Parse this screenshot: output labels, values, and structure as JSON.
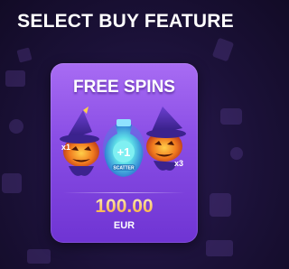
{
  "header": {
    "title": "SELECT BUY FEATURE"
  },
  "card": {
    "title": "FREE SPINS",
    "price": "100.00",
    "currency": "EUR",
    "art": {
      "left_badge": "x1",
      "center_badge": "+1",
      "center_label": "SCATTER",
      "right_badge": "x3"
    }
  },
  "colors": {
    "background": "#1b1138",
    "card_top": "#a86cf3",
    "card_bottom": "#6f34d3",
    "price_gold": "#ffc96a",
    "scatter_teal": "#5ee0e8"
  }
}
